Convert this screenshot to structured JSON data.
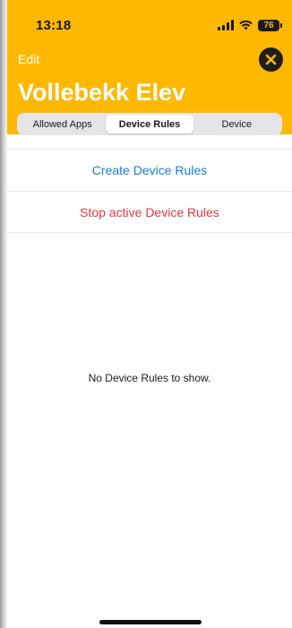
{
  "status_bar": {
    "time": "13:18",
    "battery": "76"
  },
  "header": {
    "edit_label": "Edit",
    "title": "Vollebekk Elev",
    "accent_color": "#ffb800"
  },
  "tabs": [
    {
      "label": "Allowed Apps",
      "selected": false
    },
    {
      "label": "Device Rules",
      "selected": true
    },
    {
      "label": "Device",
      "selected": false
    }
  ],
  "actions": {
    "create_label": "Create Device Rules",
    "stop_label": "Stop active Device Rules",
    "create_color": "#1d7bd6",
    "stop_color": "#e8383d"
  },
  "empty_state": "No Device Rules to show.",
  "icons": {
    "close": "close-icon",
    "signal": "cellular-signal-icon",
    "wifi": "wifi-icon",
    "battery": "battery-icon"
  }
}
